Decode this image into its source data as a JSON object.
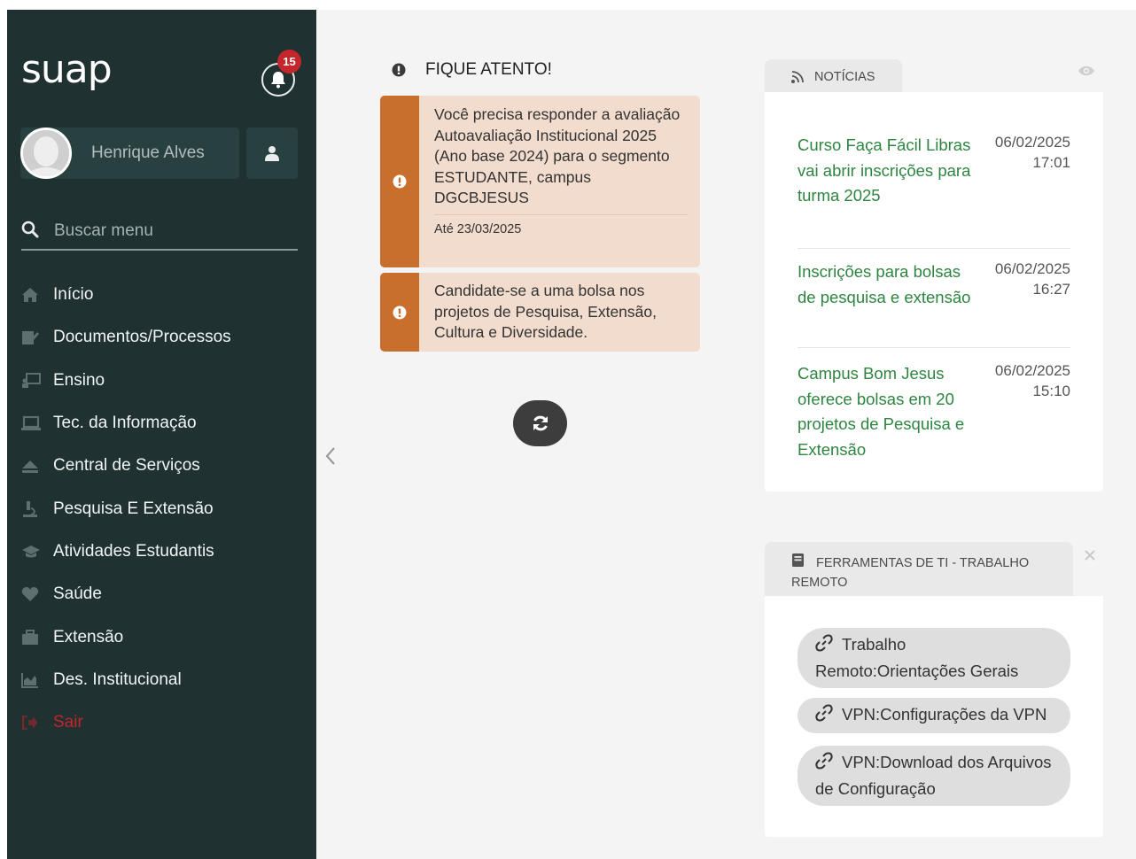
{
  "sidebar": {
    "logo": "suap",
    "notifications": {
      "count": "15"
    },
    "user": {
      "name": "Henrique Alves"
    },
    "search": {
      "placeholder": "Buscar menu"
    },
    "menu": [
      {
        "label": "Início",
        "icon": "home-icon"
      },
      {
        "label": "Documentos/Processos",
        "icon": "document-edit-icon"
      },
      {
        "label": "Ensino",
        "icon": "teaching-icon"
      },
      {
        "label": "Tec. da Informação",
        "icon": "laptop-icon"
      },
      {
        "label": "Central de Serviços",
        "icon": "eject-icon"
      },
      {
        "label": "Pesquisa E Extensão",
        "icon": "microscope-icon"
      },
      {
        "label": "Atividades Estudantis",
        "icon": "graduation-cap-icon"
      },
      {
        "label": "Saúde",
        "icon": "heart-icon"
      },
      {
        "label": "Extensão",
        "icon": "briefcase-icon"
      },
      {
        "label": "Des. Institucional",
        "icon": "area-chart-icon"
      },
      {
        "label": "Sair",
        "icon": "sign-out-icon"
      }
    ]
  },
  "alerts": {
    "title": "FIQUE ATENTO!",
    "items": [
      {
        "text": "Você precisa responder a avaliação Autoavaliação Institucional 2025 (Ano base 2024) para o segmento ESTUDANTE, campus DGCBJESUS",
        "deadline": "Até 23/03/2025"
      },
      {
        "text": "Candidate-se a uma bolsa nos projetos de Pesquisa, Extensão, Cultura e Diversidade."
      }
    ]
  },
  "news": {
    "tab_label": "NOTÍCIAS",
    "items": [
      {
        "title": "Curso Faça Fácil Libras vai abrir inscrições para turma 2025",
        "date": "06/02/2025",
        "time": "17:01"
      },
      {
        "title": "Inscrições para bolsas de pesquisa e extensão",
        "date": "06/02/2025",
        "time": "16:27"
      },
      {
        "title": "Campus Bom Jesus oferece bolsas em 20 projetos de Pesquisa e Extensão",
        "date": "06/02/2025",
        "time": "15:10"
      }
    ]
  },
  "tools": {
    "tab_label": "FERRAMENTAS DE TI - TRABALHO REMOTO",
    "links": [
      {
        "label": "Trabalho Remoto:Orientações Gerais"
      },
      {
        "label": "VPN:Configurações da VPN"
      },
      {
        "label": "VPN:Download dos Arquivos de Configuração"
      }
    ]
  },
  "colors": {
    "sidebar_bg": "#1f3130",
    "alert_accent": "#c86f2e",
    "alert_bg": "#f2dccd",
    "news_link": "#2e8540",
    "badge": "#c5262b",
    "logout": "#c4252b"
  }
}
